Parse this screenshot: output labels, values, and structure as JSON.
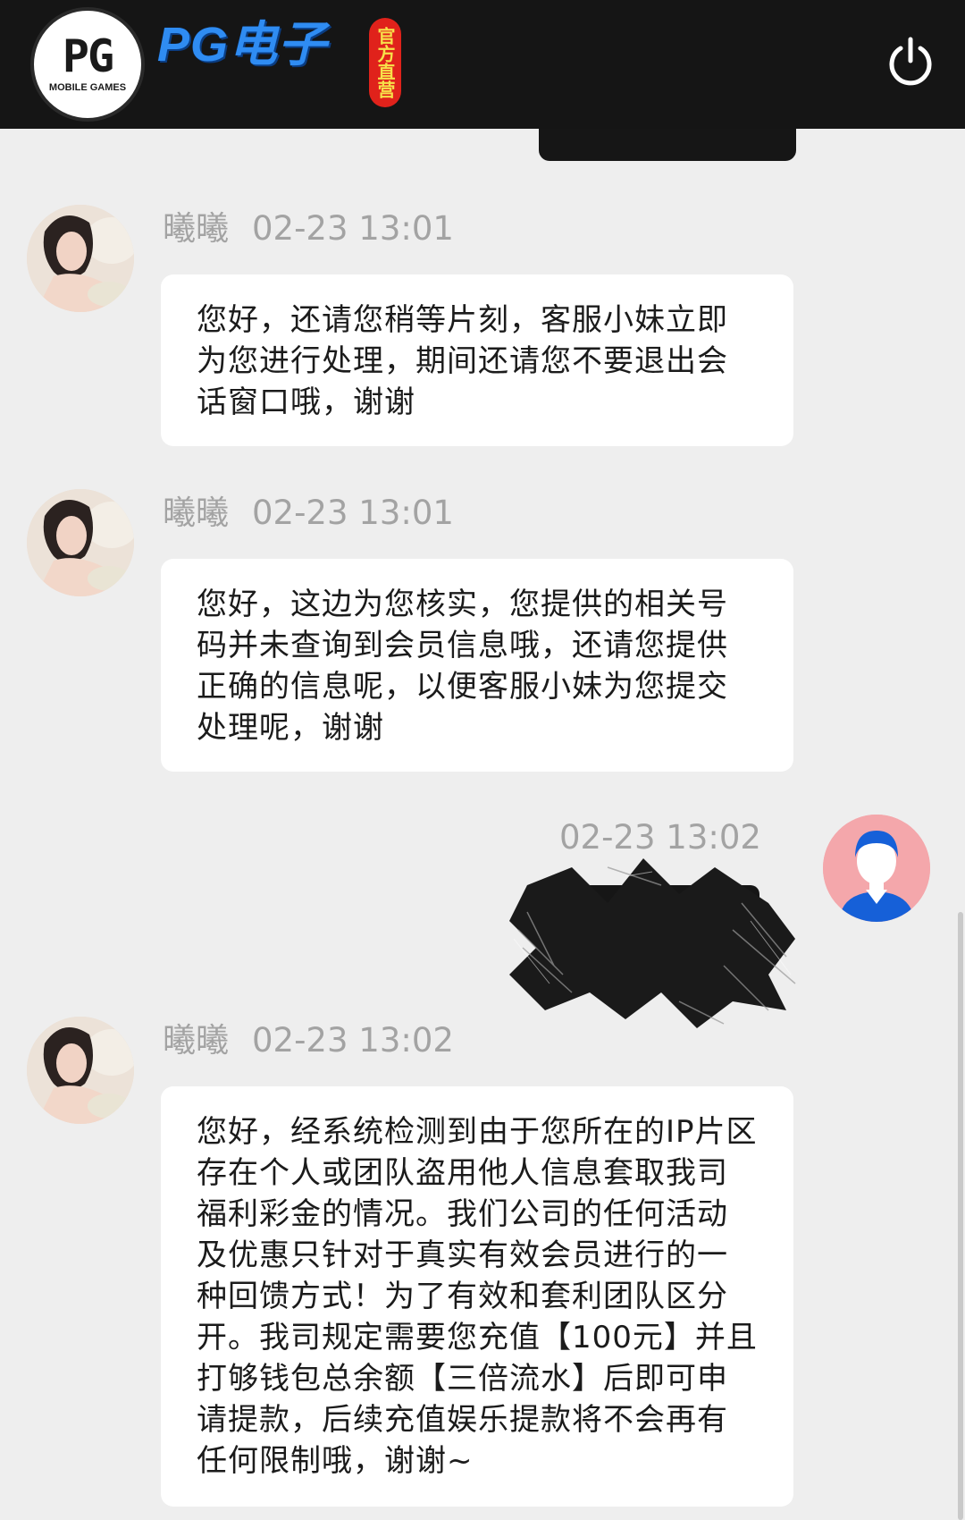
{
  "header": {
    "logo_main": "PG",
    "logo_sub": "MOBILE GAMES",
    "brand": "PG电子",
    "seal": "官方直营",
    "power_icon": "power-icon"
  },
  "colors": {
    "header_bg": "#151515",
    "brand_blue": "#2f8cf2",
    "seal_red": "#e0221b",
    "chat_bg": "#eeeeee",
    "meta_gray": "#a3a3a3",
    "user_avatar_bg": "#f4a7ab",
    "user_avatar_blue": "#1660d8"
  },
  "messages": [
    {
      "sender": "曦曦",
      "time": "02-23 13:01",
      "text": "您好，还请您稍等片刻，客服小妹立即为您进行处理，期间还请您不要退出会话窗口哦，谢谢"
    },
    {
      "sender": "曦曦",
      "time": "02-23 13:01",
      "text": "您好，这边为您核实，您提供的相关号码并未查询到会员信息哦，还请您提供正确的信息呢，以便客服小妹为您提交处理呢，谢谢"
    },
    {
      "sender": "",
      "time": "02-23 13:02",
      "text": ""
    },
    {
      "sender": "曦曦",
      "time": "02-23 13:02",
      "text": "您好，经系统检测到由于您所在的IP片区存在个人或团队盗用他人信息套取我司福利彩金的情况。我们公司的任何活动及优惠只针对于真实有效会员进行的一种回馈方式！为了有效和套利团队区分开。我司规定需要您充值【100元】并且打够钱包总余额【三倍流水】后即可申请提款，后续充值娱乐提款将不会再有任何限制哦，谢谢~"
    }
  ]
}
